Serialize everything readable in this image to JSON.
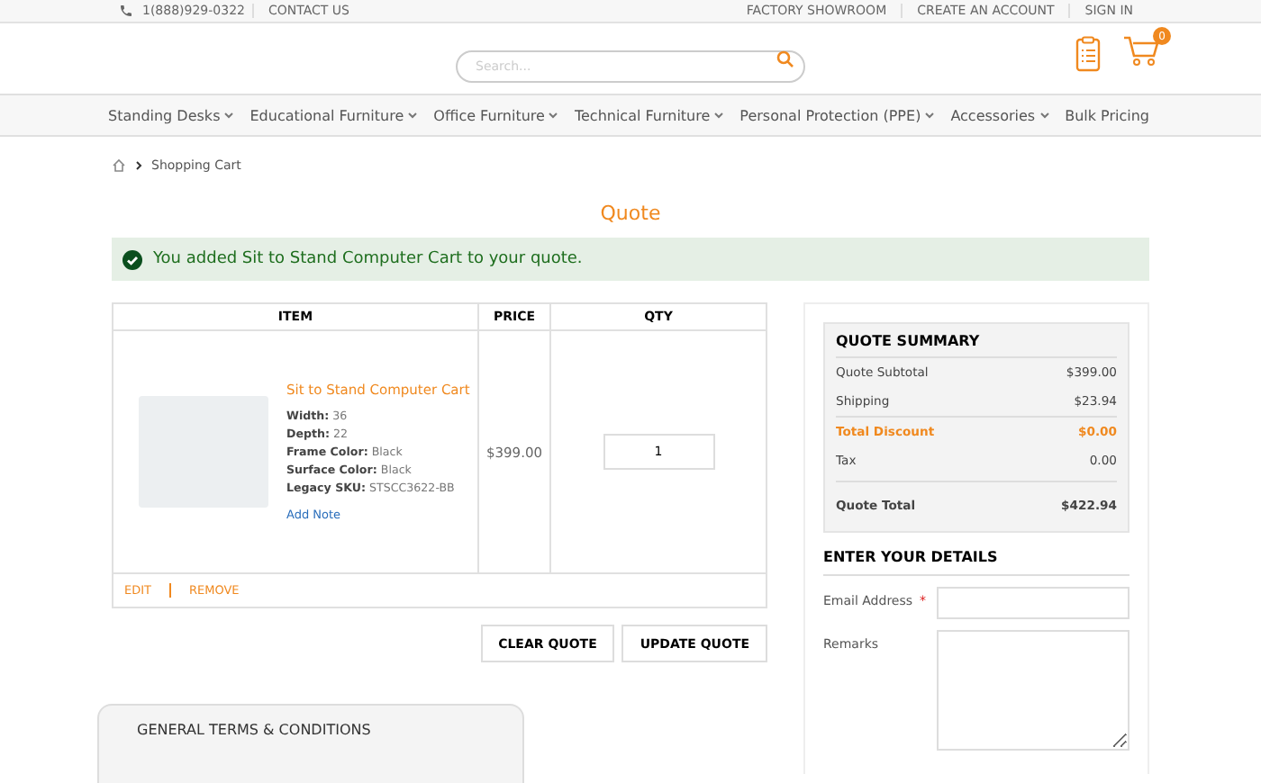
{
  "top_bar": {
    "phone": "1(888)929-0322",
    "links_left": [
      "CONTACT US"
    ],
    "links_right": [
      "FACTORY SHOWROOM",
      "CREATE AN ACCOUNT",
      "SIGN IN"
    ]
  },
  "header": {
    "search": {
      "placeholder": "Search..."
    },
    "cart_count": "0"
  },
  "nav": [
    {
      "label": "Standing Desks",
      "dropdown": true
    },
    {
      "label": "Educational Furniture",
      "dropdown": true
    },
    {
      "label": "Office Furniture",
      "dropdown": true
    },
    {
      "label": "Technical Furniture",
      "dropdown": true
    },
    {
      "label": "Personal Protection (PPE)",
      "dropdown": true
    },
    {
      "label": "Accessories",
      "dropdown": true
    },
    {
      "label": "Bulk Pricing",
      "dropdown": false
    }
  ],
  "breadcrumb": [
    "Shopping Cart"
  ],
  "page_title": "Quote",
  "alert": "You added Sit to Stand Computer Cart to your quote.",
  "table": {
    "columns": [
      "ITEM",
      "PRICE",
      "QTY"
    ],
    "rows": [
      {
        "name": "Sit to Stand Computer Cart",
        "options": [
          {
            "label": "Width:",
            "value": "36"
          },
          {
            "label": "Depth:",
            "value": "22"
          },
          {
            "label": "Frame Color:",
            "value": "Black"
          },
          {
            "label": "Surface Color:",
            "value": "Black"
          },
          {
            "label": "Legacy SKU:",
            "value": "STSCC3622-BB"
          }
        ],
        "note_link": "Add Note",
        "price": "$399.00",
        "qty": "1",
        "actions": [
          "EDIT",
          "REMOVE"
        ]
      }
    ]
  },
  "buttons": [
    "CLEAR QUOTE",
    "UPDATE QUOTE"
  ],
  "summary": {
    "title": "QUOTE SUMMARY",
    "rows": [
      {
        "kind": "plain",
        "label": "Quote Subtotal",
        "value": "$399.00"
      },
      {
        "kind": "plain",
        "label": "Shipping",
        "value": "$23.94"
      },
      {
        "kind": "discount",
        "label": "Total Discount",
        "value": "$0.00"
      },
      {
        "kind": "plain",
        "label": "Tax",
        "value": "0.00"
      },
      {
        "kind": "total",
        "label": "Quote Total",
        "value": "$422.94"
      }
    ]
  },
  "details": {
    "title": "ENTER YOUR DETAILS",
    "fields": [
      {
        "kind": "input",
        "label": "Email Address",
        "required_mark": "*"
      },
      {
        "kind": "textarea",
        "label": "Remarks"
      }
    ]
  },
  "terms": {
    "title": "GENERAL TERMS & CONDITIONS"
  }
}
